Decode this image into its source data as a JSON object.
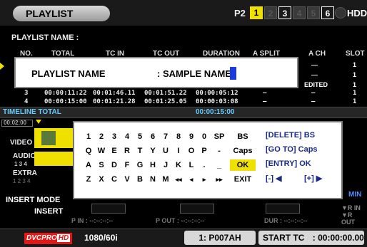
{
  "header": {
    "title": "PLAYLIST",
    "p2_label": "P2",
    "slots": [
      "1",
      "2",
      "3",
      "4",
      "5",
      "6"
    ],
    "hdd_label": "HDD"
  },
  "playlist_name_label": "PLAYLIST NAME :",
  "columns": [
    "NO.",
    "TOTAL",
    "TC IN",
    "TC OUT",
    "DURATION",
    "A SPLIT",
    "A CH",
    "SLOT"
  ],
  "rows": [
    {
      "no": "3",
      "total": "00:00:11:22",
      "tc_in": "00:01:46.11",
      "tc_out": "00:01:51.22",
      "duration": "00:00:05:12",
      "a_split": "—",
      "a_ch": "—",
      "slot": "1"
    },
    {
      "no": "4",
      "total": "00:00:15:00",
      "tc_in": "00:01:21.28",
      "tc_out": "00:01:25.05",
      "duration": "00:00:03:08",
      "a_split": "—",
      "a_ch": "—",
      "slot": "1"
    }
  ],
  "a_ch_values": [
    "—",
    "—",
    "EDITED"
  ],
  "slot_values": [
    "1",
    "1",
    "1"
  ],
  "dialog": {
    "label": "PLAYLIST NAME",
    "value": ": SAMPLE NAME"
  },
  "timeline": {
    "label": "TIMELINE TOTAL",
    "total": "00:00:15:00",
    "timecode": "00:02:00"
  },
  "tracks": {
    "video": "VIDEO",
    "audio": "AUDIO",
    "audio_ch": "1 3 4",
    "extra": "EXTRA",
    "extra_ch": "1 2 3 4"
  },
  "insert": {
    "mode_label": "INSERT MODE",
    "mode_value": "INSERT"
  },
  "bottom_labels": {
    "p_in": "P IN : --:--:--:--",
    "p_out": "P OUT : --:--:--:--",
    "dur": "DUR : --:--:--:--",
    "vr_in": "▼R IN",
    "vr_out": "▼R OUT",
    "min": "MIN"
  },
  "keyboard": {
    "row1": [
      "1",
      "2",
      "3",
      "4",
      "5",
      "6",
      "7",
      "8",
      "9",
      "0",
      "SP",
      "BS"
    ],
    "row2": [
      "Q",
      "W",
      "E",
      "R",
      "T",
      "Y",
      "U",
      "I",
      "O",
      "P",
      "-",
      "Caps"
    ],
    "row3": [
      "A",
      "S",
      "D",
      "F",
      "G",
      "H",
      "J",
      "K",
      "L",
      ".",
      "_",
      "OK"
    ],
    "row4": [
      "Z",
      "X",
      "C",
      "V",
      "B",
      "N",
      "M",
      "◂◂",
      "◂",
      "▸",
      "▸▸",
      "EXIT"
    ],
    "hints": [
      "[DELETE] BS",
      "[GO TO] Caps",
      "[ENTRY]   OK",
      "[-] ◀",
      "[+] ▶"
    ]
  },
  "status": {
    "codec_a": "DVCPRO",
    "codec_b": "HD",
    "format": "1080/60i",
    "clip": "1: P007AH",
    "start_label": "START TC",
    "start_value": ": 00:00:00.00"
  }
}
